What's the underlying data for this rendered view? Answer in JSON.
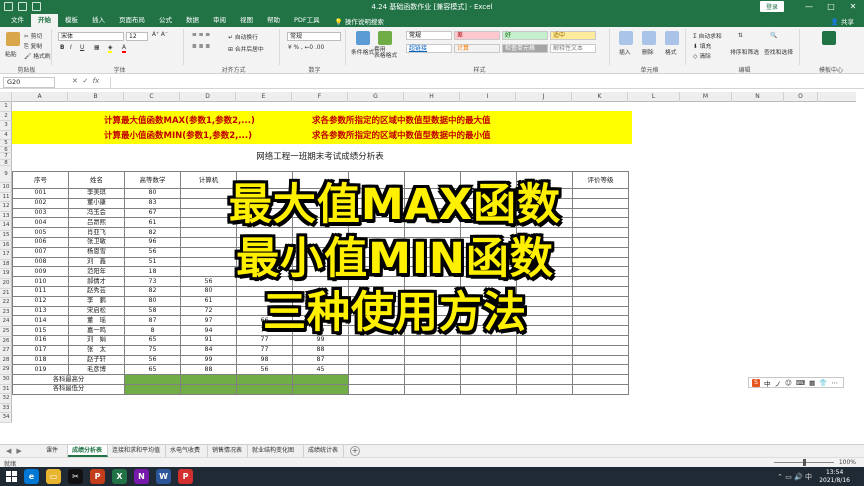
{
  "window": {
    "title": "4.24 基础函数作业 [兼容模式] - Excel",
    "login_label": "登录",
    "controls": [
      "—",
      "□",
      "✕"
    ]
  },
  "ribbon_tabs": [
    "文件",
    "开始",
    "模板",
    "插入",
    "页面布局",
    "公式",
    "数据",
    "审阅",
    "视图",
    "帮助",
    "PDF工具"
  ],
  "active_tab": "开始",
  "tell_me": "操作说明搜索",
  "share": "共享",
  "ribbon": {
    "clipboard": {
      "paste": "粘贴",
      "cut": "剪切",
      "copy": "复制",
      "format_painter": "格式刷",
      "label": "剪贴板"
    },
    "font": {
      "name": "宋体",
      "size": "12",
      "label": "字体",
      "bold": "B",
      "italic": "I",
      "underline": "U"
    },
    "alignment": {
      "wrap": "自动换行",
      "merge": "合并后居中",
      "label": "对齐方式"
    },
    "number": {
      "format": "常规",
      "label": "数字"
    },
    "styles": {
      "conditional": "条件格式",
      "table": "套用\n表格格式",
      "cells": [
        {
          "label": "常规",
          "bg": "#ffffff",
          "fg": "#000000"
        },
        {
          "label": "差",
          "bg": "#ffc7ce",
          "fg": "#9c0006"
        },
        {
          "label": "好",
          "bg": "#c6efce",
          "fg": "#006100"
        },
        {
          "label": "适中",
          "bg": "#ffeb9c",
          "fg": "#9c6500"
        },
        {
          "label": "超链接",
          "bg": "#ffffff",
          "fg": "#0563c1"
        },
        {
          "label": "计算",
          "bg": "#f2f2f2",
          "fg": "#fa7d00"
        },
        {
          "label": "检查单元格",
          "bg": "#a5a5a5",
          "fg": "#ffffff"
        },
        {
          "label": "解释性文本",
          "bg": "#ffffff",
          "fg": "#7f7f7f"
        }
      ],
      "label": "样式"
    },
    "cells": {
      "insert": "插入",
      "delete": "删除",
      "format": "格式",
      "label": "单元格"
    },
    "editing": {
      "autosum": "自动求和",
      "fill": "填充",
      "clear": "清除",
      "sort": "排序和筛选",
      "find": "查找和选择",
      "label": "编辑"
    },
    "office": {
      "label": "模板中心"
    }
  },
  "formula_bar": {
    "cell_ref": "G20",
    "fx": "fx",
    "value": ""
  },
  "columns": [
    "A",
    "B",
    "C",
    "D",
    "E",
    "F",
    "G",
    "H",
    "I",
    "J",
    "K",
    "L",
    "M",
    "N",
    "O"
  ],
  "rows": [
    "1",
    "2",
    "3",
    "4",
    "5",
    "6",
    "7",
    "8",
    "9",
    "10",
    "11",
    "12",
    "13",
    "14",
    "15",
    "16",
    "17",
    "18",
    "19",
    "20",
    "21",
    "22",
    "23",
    "24",
    "25",
    "26",
    "27",
    "28",
    "29",
    "30",
    "31",
    "32",
    "33",
    "34"
  ],
  "banner": {
    "line1_formula": "计算最大值函数MAX(参数1,参数2,...)",
    "line1_desc": "求各参数所指定的区域中数值型数据中的最大值",
    "line2_formula": "计算最小值函数MIN(参数1,参数2,...)",
    "line2_desc": "求各参数所指定的区域中数值型数据中的最小值"
  },
  "sheet_title": "网络工程一班期末考试成绩分析表",
  "table": {
    "headers": [
      "序号",
      "姓名",
      "高等数学",
      "计算机",
      "",
      "",
      "",
      "",
      "",
      "",
      "评价等级"
    ],
    "rows": [
      [
        "001",
        "李美琪",
        "80",
        "",
        "",
        ""
      ],
      [
        "002",
        "董小康",
        "83",
        "",
        "",
        ""
      ],
      [
        "003",
        "冯玉会",
        "67",
        "",
        "",
        ""
      ],
      [
        "004",
        "吕昂熙",
        "61",
        "",
        "",
        ""
      ],
      [
        "005",
        "肖亚飞",
        "82",
        "",
        "",
        ""
      ],
      [
        "006",
        "张卫敏",
        "96",
        "",
        "",
        ""
      ],
      [
        "007",
        "杨恩雪",
        "56",
        "",
        "",
        ""
      ],
      [
        "008",
        "刘　鑫",
        "51",
        "",
        "",
        ""
      ],
      [
        "009",
        "范阳年",
        "18",
        "",
        "",
        ""
      ],
      [
        "010",
        "郝倩才",
        "73",
        "56",
        "",
        ""
      ],
      [
        "011",
        "赵秀芸",
        "82",
        "80",
        "",
        ""
      ],
      [
        "012",
        "李　鹏",
        "80",
        "61",
        "",
        ""
      ],
      [
        "013",
        "宋启松",
        "58",
        "72",
        "",
        ""
      ],
      [
        "014",
        "董　瑶",
        "87",
        "97",
        "66",
        ""
      ],
      [
        "015",
        "嘉一鸣",
        "8",
        "94",
        "76",
        "99"
      ],
      [
        "016",
        "刘　娟",
        "65",
        "91",
        "77",
        "99"
      ],
      [
        "017",
        "张　太",
        "75",
        "84",
        "77",
        "88"
      ],
      [
        "018",
        "赵子轩",
        "56",
        "99",
        "98",
        "87"
      ],
      [
        "019",
        "毛彦博",
        "65",
        "88",
        "56",
        "45"
      ]
    ],
    "summary": [
      {
        "label": "各科最高分"
      },
      {
        "label": "各科最低分"
      }
    ]
  },
  "overlay": {
    "line1": "最大值MAX函数",
    "line2": "最小值MIN函数",
    "line3": "三种使用方法"
  },
  "ime": {
    "logo": "S",
    "items": [
      "中",
      "ノ",
      "☺",
      "⌨",
      "▦",
      "👕",
      "⋯"
    ]
  },
  "sheet_tabs": [
    "课件",
    "成绩分析表",
    "连接和求和平均值",
    "水电气收费表",
    "销售情况表",
    "就业结构变化图",
    "成绩统计表"
  ],
  "active_sheet": "成绩分析表",
  "status": {
    "ready": "就绪",
    "zoom": "100%"
  },
  "taskbar": {
    "apps": [
      {
        "name": "edge",
        "label": "e",
        "color": "#0078d4"
      },
      {
        "name": "folder",
        "label": "▭",
        "color": "#e8b530"
      },
      {
        "name": "capcut",
        "label": "✂",
        "color": "#111111"
      },
      {
        "name": "powerpoint",
        "label": "P",
        "color": "#c43e1c"
      },
      {
        "name": "excel",
        "label": "X",
        "color": "#217346"
      },
      {
        "name": "onenote",
        "label": "N",
        "color": "#7719aa"
      },
      {
        "name": "word",
        "label": "W",
        "color": "#2b579a"
      },
      {
        "name": "pdf",
        "label": "P",
        "color": "#d32f2f"
      }
    ],
    "time": "13:54",
    "date": "2021/8/16"
  }
}
